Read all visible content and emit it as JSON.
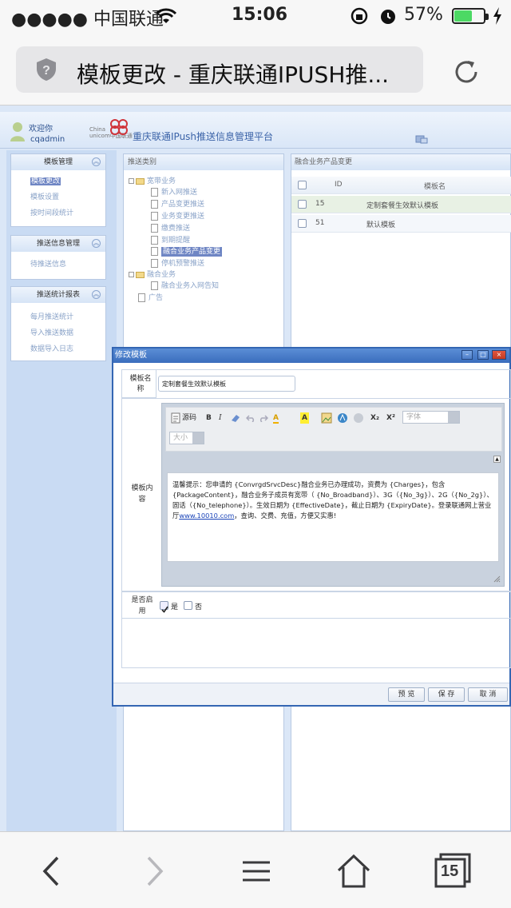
{
  "status_bar": {
    "carrier": "●●●●● 中国联通",
    "time": "15:06",
    "battery_percent": "57%",
    "battery_level": 0.57
  },
  "browser": {
    "page_title": "模板更改 - 重庆联通IPUSH推..."
  },
  "header": {
    "welcome": "欢迎你",
    "username": "cqadmin",
    "logo_text_line1": "China",
    "logo_text_line2": "unicom中国联通",
    "platform_title": "重庆联通IPush推送信息管理平台"
  },
  "left_menu": {
    "panels": [
      {
        "title": "模板管理",
        "items": [
          "模板更改",
          "模板设置",
          "按时间段统计"
        ]
      },
      {
        "title": "推送信息管理",
        "items": [
          "待推送信息"
        ]
      },
      {
        "title": "推送统计报表",
        "items": [
          "每月推送统计",
          "导入推送数据",
          "数据导入日志"
        ]
      }
    ]
  },
  "tree": {
    "header": "推送类别",
    "nodes": [
      {
        "label": "宽带业务"
      },
      {
        "label": "新入网推送"
      },
      {
        "label": "产品变更推送"
      },
      {
        "label": "业务变更推送"
      },
      {
        "label": "缴费推送"
      },
      {
        "label": "到期提醒"
      },
      {
        "label": "融合业务产品变更"
      },
      {
        "label": "停机预警推送"
      },
      {
        "label": "融合业务"
      },
      {
        "label": "融合业务入网告知"
      },
      {
        "label": "广告"
      }
    ]
  },
  "grid": {
    "header": "融合业务产品变更",
    "columns": [
      "ID",
      "模板名"
    ],
    "rows": [
      {
        "id": "15",
        "name": "定制套餐生效默认模板"
      },
      {
        "id": "51",
        "name": "默认模板"
      }
    ]
  },
  "modal": {
    "title": "修改模板",
    "name_label_1": "模板名",
    "name_label_2": "称",
    "name_value": "定制套餐生效默认模板",
    "content_label_1": "模板内",
    "content_label_2": "容",
    "toolbar": {
      "source": "源码",
      "bold": "B",
      "italic": "I",
      "font_placeholder": "字体",
      "size_placeholder": "大小",
      "subscript": "X₂",
      "superscript": "X²",
      "font_color": "A",
      "bg_color": "A"
    },
    "content": {
      "part1": "温馨提示：您申请的 {ConvrgdSrvcDesc}融合业务已办理成功，资费为 {Charges}，包含 {PackageContent}，融合业务子成员有宽带（ {No_Broadband}）、3G（{No_3g}）、2G（{No_2g}）、固话（{No_telephone}）。生效日期为 {EffectiveDate}，截止日期为 {ExpiryDate}。登录联通网上营业厅",
      "link": "www.10010.com",
      "part2": "，查询、交费、充值，方便又实惠!"
    },
    "enable_label_1": "是否启",
    "enable_label_2": "用",
    "option_yes": "是",
    "option_no": "否",
    "yes_checked": true,
    "buttons": {
      "preview": "预 览",
      "save": "保 存",
      "cancel": "取 消"
    }
  },
  "bottom_bar": {
    "tabs_count": "15"
  },
  "colors": {
    "accent": "#3466b3",
    "selection": "#6f86c4",
    "battery_green": "#4cd964"
  }
}
